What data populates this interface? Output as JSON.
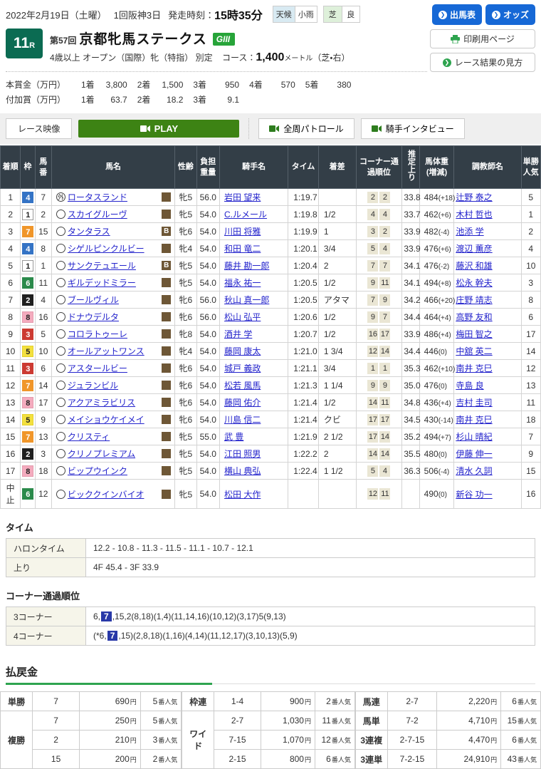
{
  "header": {
    "date": "2022年2月19日（土曜）",
    "meeting": "1回阪神3日",
    "start_label": "発走時刻：",
    "start_time": "15時35分",
    "weather_label": "天候",
    "weather_value": "小雨",
    "turf_label": "芝",
    "turf_value": "良",
    "buttons": {
      "entries": "出馬表",
      "odds": "オッズ",
      "print": "印刷用ページ",
      "guide": "レース結果の見方"
    }
  },
  "race": {
    "number": "11",
    "number_suffix": "R",
    "edition": "第57回",
    "name": "京都牝馬ステークス",
    "grade": "GIII",
    "conditions": "4歳以上 オープン（国際）牝（特指） 別定",
    "course_label": "コース：",
    "course_distance": "1,400",
    "course_unit": "メートル",
    "course_note": "（芝・右）"
  },
  "prize": {
    "main_label": "本賞金（万円）",
    "main": [
      {
        "k": "1着",
        "v": "3,800"
      },
      {
        "k": "2着",
        "v": "1,500"
      },
      {
        "k": "3着",
        "v": "950"
      },
      {
        "k": "4着",
        "v": "570"
      },
      {
        "k": "5着",
        "v": "380"
      }
    ],
    "extra_label": "付加賞（万円）",
    "extra": [
      {
        "k": "1着",
        "v": "63.7"
      },
      {
        "k": "2着",
        "v": "18.2"
      },
      {
        "k": "3着",
        "v": "9.1"
      }
    ]
  },
  "video": {
    "label": "レース映像",
    "play": "PLAY",
    "patrol": "全周パトロール",
    "interview": "騎手インタビュー"
  },
  "results": {
    "headers": [
      "着順",
      "枠",
      "馬番",
      "馬名",
      "性齢",
      "負担重量",
      "騎手名",
      "タイム",
      "着差",
      "コーナー通過順位",
      "推定上り",
      "馬体重(増減)",
      "調教師名",
      "単勝人気"
    ],
    "blinker_label": "B",
    "rows": [
      {
        "pos": "1",
        "frame": "4",
        "num": "7",
        "mark": "外",
        "blinker": false,
        "name": "ロータスランド",
        "sexage": "牝5",
        "weight": "56.0",
        "jockey": "岩田 望来",
        "time": "1:19.7",
        "margin": "",
        "corners": [
          "2",
          "2"
        ],
        "agari": "33.8",
        "hw": "484",
        "hwd": "(+18)",
        "trainer": "辻野 泰之",
        "pop": "5"
      },
      {
        "pos": "2",
        "frame": "1",
        "num": "2",
        "mark": "",
        "blinker": false,
        "name": "スカイグルーヴ",
        "sexage": "牝5",
        "weight": "54.0",
        "jockey": "C.ルメール",
        "time": "1:19.8",
        "margin": "1/2",
        "corners": [
          "4",
          "4"
        ],
        "agari": "33.7",
        "hw": "462",
        "hwd": "(+6)",
        "trainer": "木村 哲也",
        "pop": "1"
      },
      {
        "pos": "3",
        "frame": "7",
        "num": "15",
        "mark": "",
        "blinker": true,
        "name": "タンタラス",
        "sexage": "牝6",
        "weight": "54.0",
        "jockey": "川田 将雅",
        "time": "1:19.9",
        "margin": "1",
        "corners": [
          "3",
          "2"
        ],
        "agari": "33.9",
        "hw": "482",
        "hwd": "(-4)",
        "trainer": "池添 学",
        "pop": "2"
      },
      {
        "pos": "4",
        "frame": "4",
        "num": "8",
        "mark": "",
        "blinker": false,
        "name": "シゲルピンクルビー",
        "sexage": "牝4",
        "weight": "54.0",
        "jockey": "和田 竜二",
        "time": "1:20.1",
        "margin": "3/4",
        "corners": [
          "5",
          "4"
        ],
        "agari": "33.9",
        "hw": "476",
        "hwd": "(+6)",
        "trainer": "渡辺 薫彦",
        "pop": "4"
      },
      {
        "pos": "5",
        "frame": "1",
        "num": "1",
        "mark": "",
        "blinker": true,
        "name": "サンクテュエール",
        "sexage": "牝5",
        "weight": "54.0",
        "jockey": "藤井 勘一郎",
        "time": "1:20.4",
        "margin": "2",
        "corners": [
          "7",
          "7"
        ],
        "agari": "34.1",
        "hw": "476",
        "hwd": "(-2)",
        "trainer": "藤沢 和雄",
        "pop": "10"
      },
      {
        "pos": "6",
        "frame": "6",
        "num": "11",
        "mark": "",
        "blinker": false,
        "name": "ギルデッドミラー",
        "sexage": "牝5",
        "weight": "54.0",
        "jockey": "福永 祐一",
        "time": "1:20.5",
        "margin": "1/2",
        "corners": [
          "9",
          "11"
        ],
        "agari": "34.1",
        "hw": "494",
        "hwd": "(+8)",
        "trainer": "松永 幹夫",
        "pop": "3"
      },
      {
        "pos": "7",
        "frame": "2",
        "num": "4",
        "mark": "",
        "blinker": false,
        "name": "ブールヴィル",
        "sexage": "牝6",
        "weight": "56.0",
        "jockey": "秋山 真一郎",
        "time": "1:20.5",
        "margin": "アタマ",
        "corners": [
          "7",
          "9"
        ],
        "agari": "34.2",
        "hw": "466",
        "hwd": "(+20)",
        "trainer": "庄野 靖志",
        "pop": "8"
      },
      {
        "pos": "8",
        "frame": "8",
        "num": "16",
        "mark": "",
        "blinker": false,
        "name": "ドナウデルタ",
        "sexage": "牝6",
        "weight": "56.0",
        "jockey": "松山 弘平",
        "time": "1:20.6",
        "margin": "1/2",
        "corners": [
          "9",
          "7"
        ],
        "agari": "34.4",
        "hw": "464",
        "hwd": "(+4)",
        "trainer": "高野 友和",
        "pop": "6"
      },
      {
        "pos": "9",
        "frame": "3",
        "num": "5",
        "mark": "",
        "blinker": false,
        "name": "コロラトゥーレ",
        "sexage": "牝8",
        "weight": "54.0",
        "jockey": "酒井 学",
        "time": "1:20.7",
        "margin": "1/2",
        "corners": [
          "16",
          "17"
        ],
        "agari": "33.9",
        "hw": "486",
        "hwd": "(+4)",
        "trainer": "梅田 智之",
        "pop": "17"
      },
      {
        "pos": "10",
        "frame": "5",
        "num": "10",
        "mark": "",
        "blinker": false,
        "name": "オールアットワンス",
        "sexage": "牝4",
        "weight": "54.0",
        "jockey": "藤岡 康太",
        "time": "1:21.0",
        "margin": "1 3/4",
        "corners": [
          "12",
          "14"
        ],
        "agari": "34.4",
        "hw": "446",
        "hwd": "(0)",
        "trainer": "中舘 英二",
        "pop": "14"
      },
      {
        "pos": "11",
        "frame": "3",
        "num": "6",
        "mark": "",
        "blinker": false,
        "name": "アスタールビー",
        "sexage": "牝6",
        "weight": "54.0",
        "jockey": "城戸 義政",
        "time": "1:21.1",
        "margin": "3/4",
        "corners": [
          "1",
          "1"
        ],
        "agari": "35.3",
        "hw": "462",
        "hwd": "(+10)",
        "trainer": "南井 克巳",
        "pop": "12"
      },
      {
        "pos": "12",
        "frame": "7",
        "num": "14",
        "mark": "",
        "blinker": false,
        "name": "ジュランビル",
        "sexage": "牝6",
        "weight": "54.0",
        "jockey": "松若 風馬",
        "time": "1:21.3",
        "margin": "1 1/4",
        "corners": [
          "9",
          "9"
        ],
        "agari": "35.0",
        "hw": "476",
        "hwd": "(0)",
        "trainer": "寺島 良",
        "pop": "13"
      },
      {
        "pos": "13",
        "frame": "8",
        "num": "17",
        "mark": "",
        "blinker": false,
        "name": "アクアミラビリス",
        "sexage": "牝6",
        "weight": "54.0",
        "jockey": "藤岡 佑介",
        "time": "1:21.4",
        "margin": "1/2",
        "corners": [
          "14",
          "11"
        ],
        "agari": "34.8",
        "hw": "436",
        "hwd": "(+4)",
        "trainer": "吉村 圭司",
        "pop": "11"
      },
      {
        "pos": "14",
        "frame": "5",
        "num": "9",
        "mark": "",
        "blinker": false,
        "name": "メイショウケイメイ",
        "sexage": "牝6",
        "weight": "54.0",
        "jockey": "川島 信二",
        "time": "1:21.4",
        "margin": "クビ",
        "corners": [
          "17",
          "17"
        ],
        "agari": "34.5",
        "hw": "430",
        "hwd": "(-14)",
        "trainer": "南井 克巳",
        "pop": "18"
      },
      {
        "pos": "15",
        "frame": "7",
        "num": "13",
        "mark": "",
        "blinker": false,
        "name": "クリスティ",
        "sexage": "牝5",
        "weight": "55.0",
        "jockey": "武 豊",
        "time": "1:21.9",
        "margin": "2 1/2",
        "corners": [
          "17",
          "14"
        ],
        "agari": "35.2",
        "hw": "494",
        "hwd": "(+7)",
        "trainer": "杉山 晴紀",
        "pop": "7"
      },
      {
        "pos": "16",
        "frame": "2",
        "num": "3",
        "mark": "",
        "blinker": false,
        "name": "クリノプレミアム",
        "sexage": "牝5",
        "weight": "54.0",
        "jockey": "江田 照男",
        "time": "1:22.2",
        "margin": "2",
        "corners": [
          "14",
          "14"
        ],
        "agari": "35.5",
        "hw": "480",
        "hwd": "(0)",
        "trainer": "伊藤 伸一",
        "pop": "9"
      },
      {
        "pos": "17",
        "frame": "8",
        "num": "18",
        "mark": "",
        "blinker": false,
        "name": "ビップウインク",
        "sexage": "牝5",
        "weight": "54.0",
        "jockey": "横山 典弘",
        "time": "1:22.4",
        "margin": "1 1/2",
        "corners": [
          "5",
          "4"
        ],
        "agari": "36.3",
        "hw": "506",
        "hwd": "(-4)",
        "trainer": "清水 久詞",
        "pop": "15"
      },
      {
        "pos": "中止",
        "frame": "6",
        "num": "12",
        "mark": "",
        "blinker": false,
        "name": "ビッククインバイオ",
        "sexage": "牝5",
        "weight": "54.0",
        "jockey": "松田 大作",
        "time": "",
        "margin": "",
        "corners": [
          "12",
          "11"
        ],
        "agari": "",
        "hw": "490",
        "hwd": "(0)",
        "trainer": "新谷 功一",
        "pop": "16"
      }
    ]
  },
  "time_section": {
    "title": "タイム",
    "rows": [
      {
        "label": "ハロンタイム",
        "value": "12.2 - 10.8 - 11.3 - 11.5 - 11.1 - 10.7 - 12.1"
      },
      {
        "label": "上り",
        "value": "4F 45.4 - 3F 33.9"
      }
    ]
  },
  "corner_section": {
    "title": "コーナー通過順位",
    "rows": [
      {
        "label": "3コーナー",
        "prefix": "6,",
        "highlight": "7",
        "suffix": ",15,2(8,18)(1,4)(11,14,16)(10,12)(3,17)5(9,13)"
      },
      {
        "label": "4コーナー",
        "prefix": "(*6,",
        "highlight": "7",
        "suffix": ",15)(2,8,18)(1,16)(4,14)(11,12,17)(3,10,13)(5,9)"
      }
    ]
  },
  "payout": {
    "title": "払戻金",
    "yen_suffix": "円",
    "pop_suffix": "番人気",
    "groups": [
      {
        "rows": [
          {
            "label": "単勝",
            "combo": "7",
            "amount": "690",
            "pop": "5"
          },
          {
            "label": "複勝",
            "labelspan": 3,
            "combo": "7",
            "amount": "250",
            "pop": "5"
          },
          {
            "combo": "2",
            "amount": "210",
            "pop": "3"
          },
          {
            "combo": "15",
            "amount": "200",
            "pop": "2"
          }
        ]
      },
      {
        "rows": [
          {
            "label": "枠連",
            "combo": "1-4",
            "amount": "900",
            "pop": "2"
          },
          {
            "label": "ワイド",
            "labelspan": 3,
            "combo": "2-7",
            "amount": "1,030",
            "pop": "11"
          },
          {
            "combo": "7-15",
            "amount": "1,070",
            "pop": "12"
          },
          {
            "combo": "2-15",
            "amount": "800",
            "pop": "6"
          }
        ]
      },
      {
        "rows": [
          {
            "label": "馬連",
            "combo": "2-7",
            "amount": "2,220",
            "pop": "6"
          },
          {
            "label": "馬単",
            "combo": "7-2",
            "amount": "4,710",
            "pop": "15"
          },
          {
            "label": "3連複",
            "combo": "2-7-15",
            "amount": "4,470",
            "pop": "6"
          },
          {
            "label": "3連単",
            "combo": "7-2-15",
            "amount": "24,910",
            "pop": "43"
          }
        ]
      }
    ]
  },
  "colors": {
    "accent_blue": "#1668d6",
    "race_box_green": "#0b6b52",
    "grade_green": "#27a439",
    "play_green": "#3d8314",
    "icon_green": "#2ea44f",
    "header_bg": "#333e47",
    "link_blue": "#2323cc",
    "highlight_navy": "#2939a8",
    "frames": {
      "1": {
        "bg": "#ffffff",
        "fg": "#222222",
        "border": "#999999"
      },
      "2": {
        "bg": "#1f1f1f",
        "fg": "#ffffff",
        "border": "#1f1f1f"
      },
      "3": {
        "bg": "#cc3a32",
        "fg": "#ffffff",
        "border": "#cc3a32"
      },
      "4": {
        "bg": "#3473c5",
        "fg": "#ffffff",
        "border": "#3473c5"
      },
      "5": {
        "bg": "#f3e03e",
        "fg": "#222222",
        "border": "#e3d02e"
      },
      "6": {
        "bg": "#2b8a4b",
        "fg": "#ffffff",
        "border": "#2b8a4b"
      },
      "7": {
        "bg": "#f0962a",
        "fg": "#ffffff",
        "border": "#f0962a"
      },
      "8": {
        "bg": "#f4abbe",
        "fg": "#222222",
        "border": "#e49bae"
      }
    }
  }
}
